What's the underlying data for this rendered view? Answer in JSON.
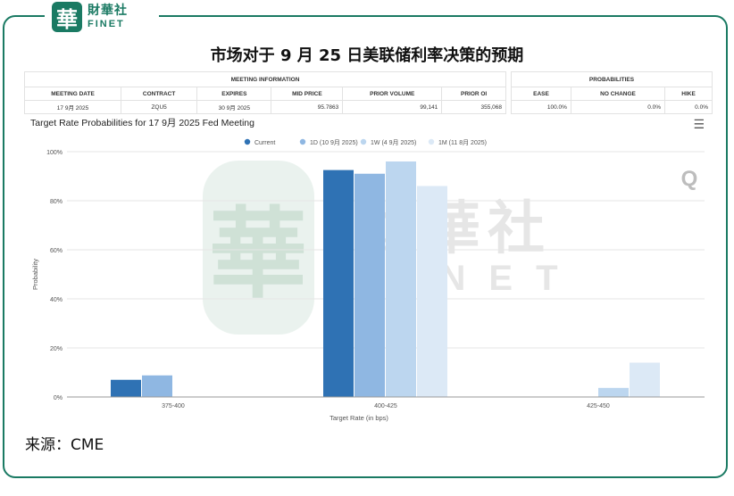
{
  "brand": {
    "seal_char": "華",
    "name_cn": "財華社",
    "name_en": "FINET"
  },
  "title": "市场对于 9 月 25 日美联储利率决策的预期",
  "meeting_table": {
    "group_header": "MEETING INFORMATION",
    "columns": [
      "MEETING DATE",
      "CONTRACT",
      "EXPIRES",
      "MID PRICE",
      "PRIOR VOLUME",
      "PRIOR OI"
    ],
    "row": [
      "17 9月 2025",
      "ZQU5",
      "30 9月 2025",
      "95.7863",
      "99,141",
      "355,068"
    ]
  },
  "prob_table": {
    "group_header": "PROBABILITIES",
    "columns": [
      "EASE",
      "NO CHANGE",
      "HIKE"
    ],
    "row": [
      "100.0%",
      "0.0%",
      "0.0%"
    ]
  },
  "chart_panel": {
    "title": "Target Rate Probabilities for 17 9月 2025 Fed Meeting",
    "menu_icon": "hamburger-menu-icon"
  },
  "watermark": {
    "seal_char": "華",
    "name_cn": "財華社",
    "name_en": "FINET",
    "corner_mark": "Q"
  },
  "chart_data": {
    "type": "bar",
    "categories": [
      "375-400",
      "400-425",
      "425-450"
    ],
    "series": [
      {
        "name": "Current",
        "color": "#2f72b4",
        "values": [
          7.0,
          92.5,
          0.0
        ]
      },
      {
        "name": "1D (10 9月 2025)",
        "color": "#8fb7e2",
        "values": [
          8.8,
          91.0,
          0.0
        ]
      },
      {
        "name": "1W (4 9月 2025)",
        "color": "#bcd6ef",
        "values": [
          0.0,
          96.0,
          3.7
        ]
      },
      {
        "name": "1M (11 8月 2025)",
        "color": "#dce9f6",
        "values": [
          0.0,
          86.0,
          14.0
        ]
      }
    ],
    "ylim": [
      0,
      100
    ],
    "yticks": [
      "0%",
      "20%",
      "40%",
      "60%",
      "80%",
      "100%"
    ],
    "ylabel": "Probability",
    "xlabel": "Target Rate (in bps)",
    "legend_position": "top-center",
    "grid": true
  },
  "source": "来源：CME"
}
